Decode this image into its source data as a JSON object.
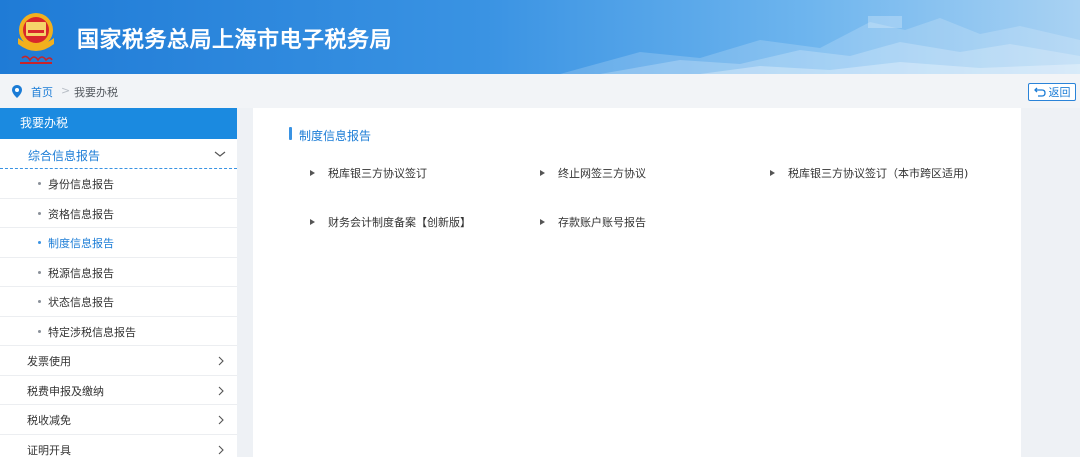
{
  "header": {
    "title": "国家税务总局上海市电子税务局"
  },
  "breadcrumb": {
    "home": "首页",
    "separator": ">",
    "current": "我要办税"
  },
  "back_button": {
    "label": "返回"
  },
  "sidebar": {
    "heading": "我要办税",
    "group": {
      "label": "综合信息报告",
      "items": [
        {
          "label": "身份信息报告",
          "active": false
        },
        {
          "label": "资格信息报告",
          "active": false
        },
        {
          "label": "制度信息报告",
          "active": true
        },
        {
          "label": "税源信息报告",
          "active": false
        },
        {
          "label": "状态信息报告",
          "active": false
        },
        {
          "label": "特定涉税信息报告",
          "active": false
        }
      ]
    },
    "menu": [
      {
        "label": "发票使用"
      },
      {
        "label": "税费申报及缴纳"
      },
      {
        "label": "税收减免"
      },
      {
        "label": "证明开具"
      }
    ]
  },
  "main": {
    "section_title": "制度信息报告",
    "links": [
      {
        "label": "税库银三方协议签订"
      },
      {
        "label": "终止网签三方协议"
      },
      {
        "label": "税库银三方协议签订（本市跨区适用)"
      },
      {
        "label": "财务会计制度备案【创新版】"
      },
      {
        "label": "存款账户账号报告"
      }
    ]
  },
  "colors": {
    "accent": "#1b7cd6",
    "sidebar_heading_bg": "#1b8ae0",
    "header_gradient_start": "#1f7bd6",
    "header_gradient_end": "#a9d2f3"
  }
}
